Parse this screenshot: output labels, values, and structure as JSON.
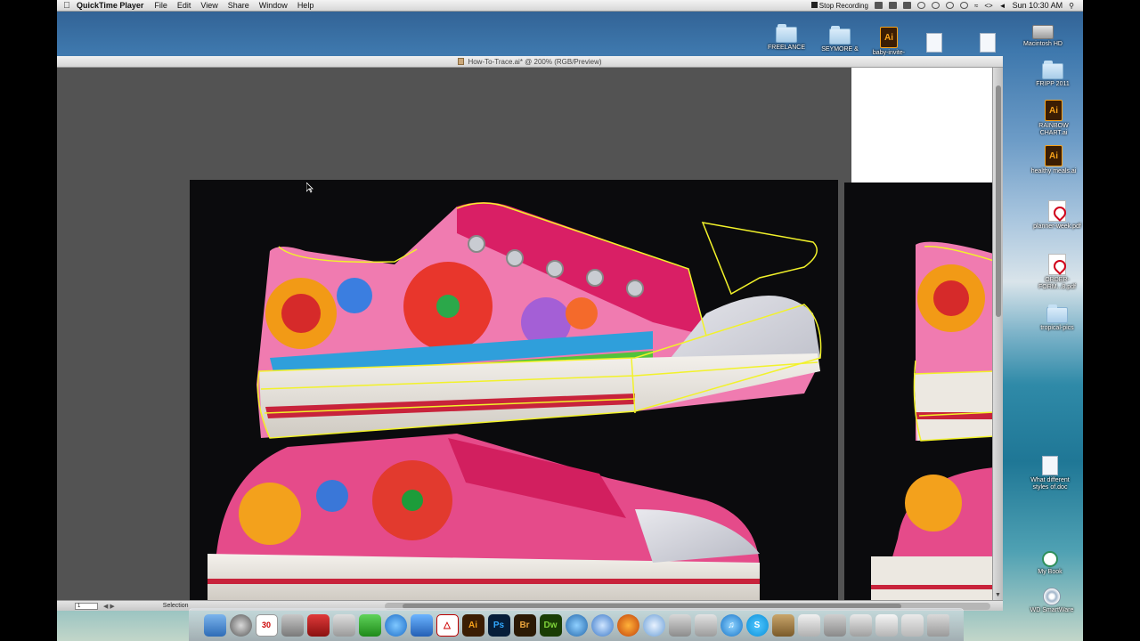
{
  "menubar": {
    "app_name": "QuickTime Player",
    "items": [
      "File",
      "Edit",
      "View",
      "Share",
      "Window",
      "Help"
    ],
    "stop_recording": "Stop Recording",
    "clock": "Sun 10:30 AM"
  },
  "desktop_icons": {
    "freelance": "FREELANCE",
    "seymore": "SEYMORE &",
    "baby_invite": "baby-invite-",
    "macintosh_hd": "Macintosh HD",
    "fripp": "FRIPP 2011",
    "rainbow_chart": "RAINBOW CHART.ai",
    "healthy_meals": "healthy meals.ai",
    "planner_week": "planner-week.pdf",
    "order_form": "ORDER-FORM...8.pdf",
    "tropical_pics": "tropical-pics",
    "what_different": "What different styles of.doc",
    "my_book": "My Book",
    "wd_smartware": "WD SmartWare"
  },
  "illustrator": {
    "doc_title": "How-To-Trace.ai* @ 200% (RGB/Preview)",
    "status_zoom": "1",
    "status_tool": "Selection"
  },
  "dock": {
    "ai_label": "Ai",
    "ps_label": "Ps",
    "br_label": "Br",
    "dw_label": "Dw",
    "calendar_day": "30"
  },
  "colors": {
    "trace_outline": "#f2f22a",
    "shoe_pink": "#e8508f",
    "laces": "#e0245e",
    "sole_stripe": "#c8233b"
  }
}
